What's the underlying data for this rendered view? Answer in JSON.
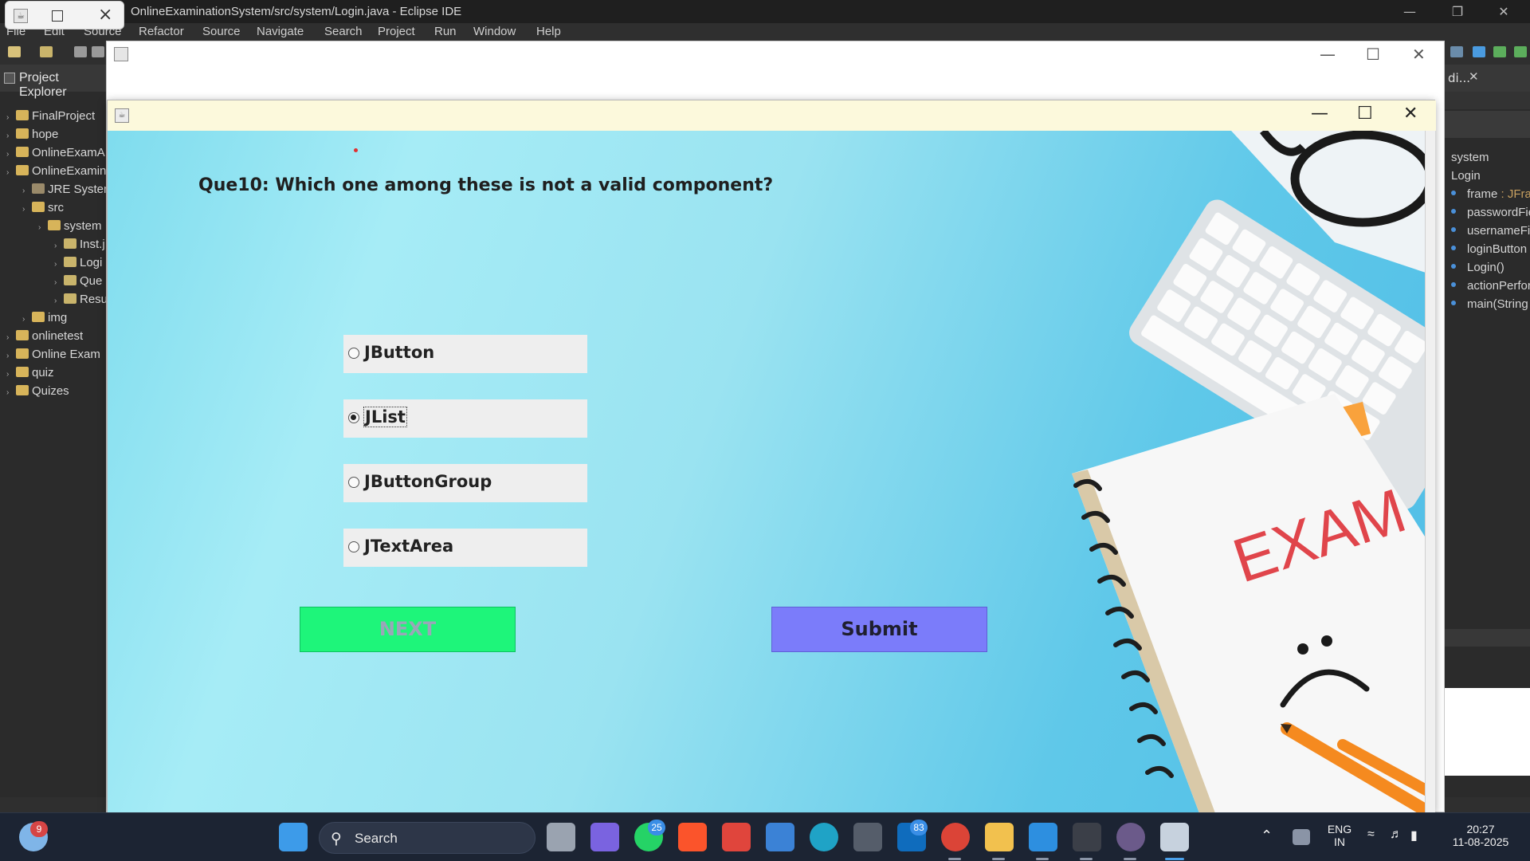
{
  "eclipse": {
    "title": "OnlineExaminationSystem/src/system/Login.java - Eclipse IDE",
    "menu": [
      "File",
      "Edit",
      "Source",
      "Refactor",
      "Source",
      "Navigate",
      "Search",
      "Project",
      "Run",
      "Window",
      "Help"
    ],
    "explorer_title": "Project Explorer",
    "tree": [
      {
        "label": "FinalProject",
        "indent": 0
      },
      {
        "label": "hope",
        "indent": 0
      },
      {
        "label": "OnlineExamA",
        "indent": 0
      },
      {
        "label": "OnlineExamin",
        "indent": 0
      },
      {
        "label": "JRE System",
        "indent": 1
      },
      {
        "label": "src",
        "indent": 1
      },
      {
        "label": "system",
        "indent": 2
      },
      {
        "label": "Inst.j",
        "indent": 3
      },
      {
        "label": "Logi",
        "indent": 3
      },
      {
        "label": "Que",
        "indent": 3
      },
      {
        "label": "Resu",
        "indent": 3
      },
      {
        "label": "img",
        "indent": 1
      },
      {
        "label": "onlinetest",
        "indent": 0
      },
      {
        "label": "Online Exam",
        "indent": 0
      },
      {
        "label": "quiz",
        "indent": 0
      },
      {
        "label": "Quizes",
        "indent": 0
      }
    ],
    "outline_tab": "di...",
    "outline": {
      "package": "system",
      "class": "Login",
      "members": [
        {
          "name": "frame",
          "type": " : JFran"
        },
        {
          "name": "passwordFie",
          "type": ""
        },
        {
          "name": "usernameFie",
          "type": ""
        },
        {
          "name": "loginButton",
          "type": ""
        },
        {
          "name": "Login()",
          "type": ""
        },
        {
          "name": "actionPerfor",
          "type": ""
        },
        {
          "name": "main(String",
          "type": ""
        }
      ]
    }
  },
  "quiz": {
    "question": "Que10: Which one among these is not a valid component?",
    "options": [
      {
        "label": "JButton",
        "selected": false
      },
      {
        "label": "JList",
        "selected": true
      },
      {
        "label": "JButtonGroup",
        "selected": false
      },
      {
        "label": "JTextArea",
        "selected": false
      }
    ],
    "next_label": "NEXT",
    "submit_label": "Submit",
    "illustration_text": "EXAM"
  },
  "taskbar": {
    "weather_badge": "9",
    "search_placeholder": "Search",
    "whatsapp_badge": "25",
    "outlook_badge": "83",
    "lang_line1": "ENG",
    "lang_line2": "IN",
    "time": "20:27",
    "date": "11-08-2025"
  }
}
